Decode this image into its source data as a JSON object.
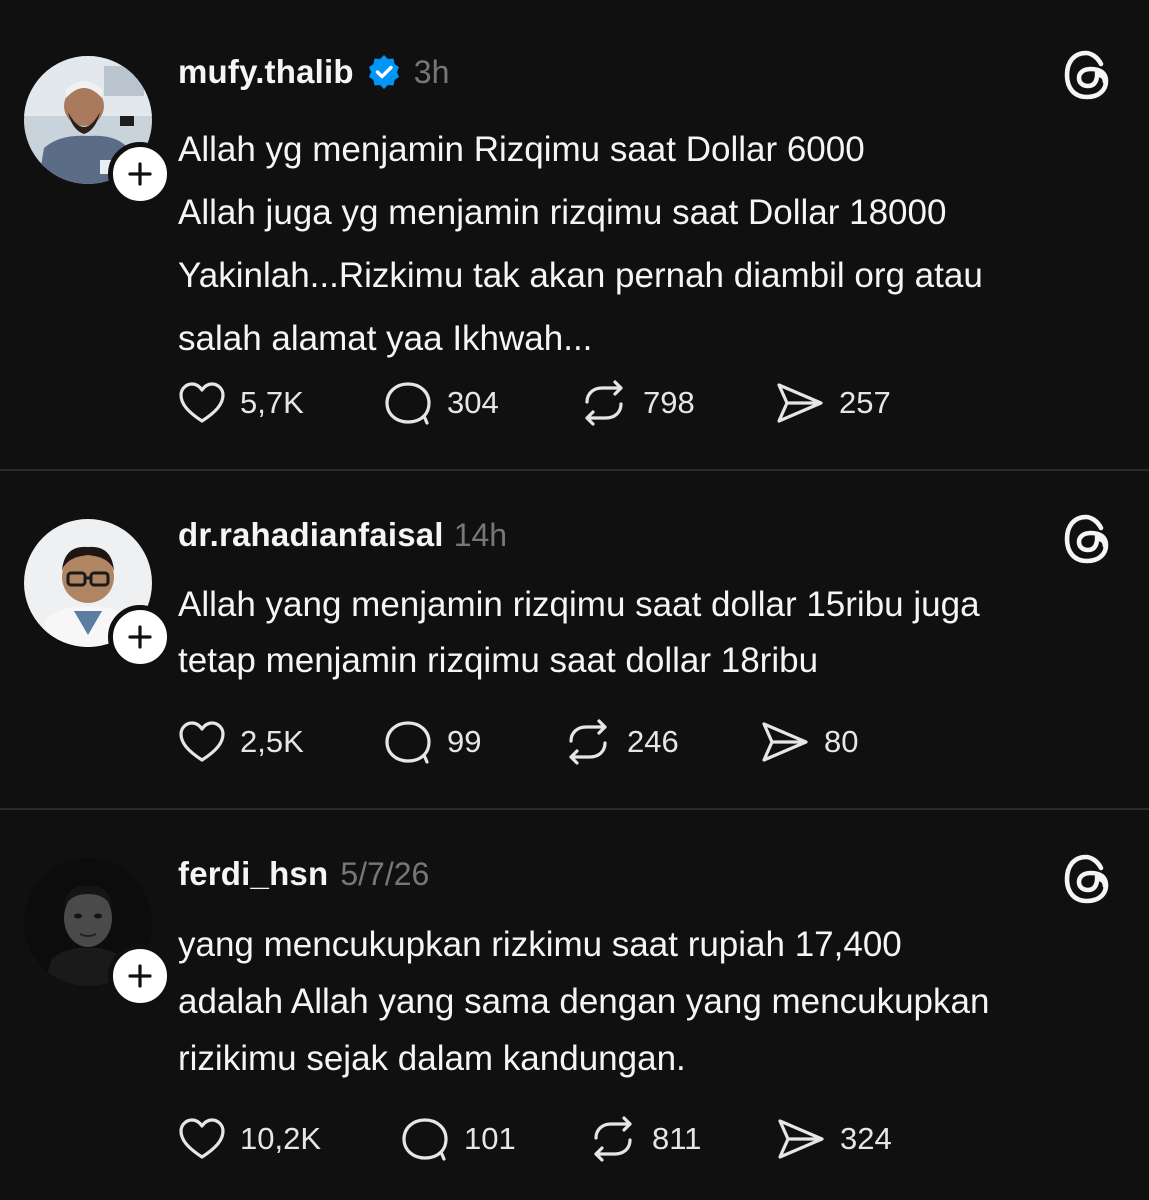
{
  "app": {
    "icon": "threads-logo-icon"
  },
  "posts": [
    {
      "username": "mufy.thalib",
      "verified": true,
      "time": "3h",
      "lines": [
        "Allah yg menjamin Rizqimu saat Dollar 6000",
        "Allah juga yg menjamin rizqimu saat Dollar 18000",
        "Yakinlah...Rizkimu tak akan pernah diambil org atau",
        "salah alamat yaa Ikhwah..."
      ],
      "likes": "5,7K",
      "replies": "304",
      "reposts": "798",
      "shares": "257"
    },
    {
      "username": "dr.rahadianfaisal",
      "verified": false,
      "time": "14h",
      "lines": [
        "Allah yang menjamin rizqimu saat dollar 15ribu juga",
        "tetap menjamin rizqimu saat dollar 18ribu"
      ],
      "likes": "2,5K",
      "replies": "99",
      "reposts": "246",
      "shares": "80"
    },
    {
      "username": "ferdi_hsn",
      "verified": false,
      "time": "5/7/26",
      "lines": [
        "yang mencukupkan rizkimu saat rupiah 17,400",
        "adalah Allah yang sama dengan yang mencukupkan",
        "rizikimu sejak dalam kandungan."
      ],
      "likes": "10,2K",
      "replies": "101",
      "reposts": "811",
      "shares": "324"
    }
  ],
  "colors": {
    "background": "#101010",
    "text": "#f3f5f7",
    "muted": "#777777",
    "verified": "#0095f6",
    "divider": "#2a2a2a"
  }
}
